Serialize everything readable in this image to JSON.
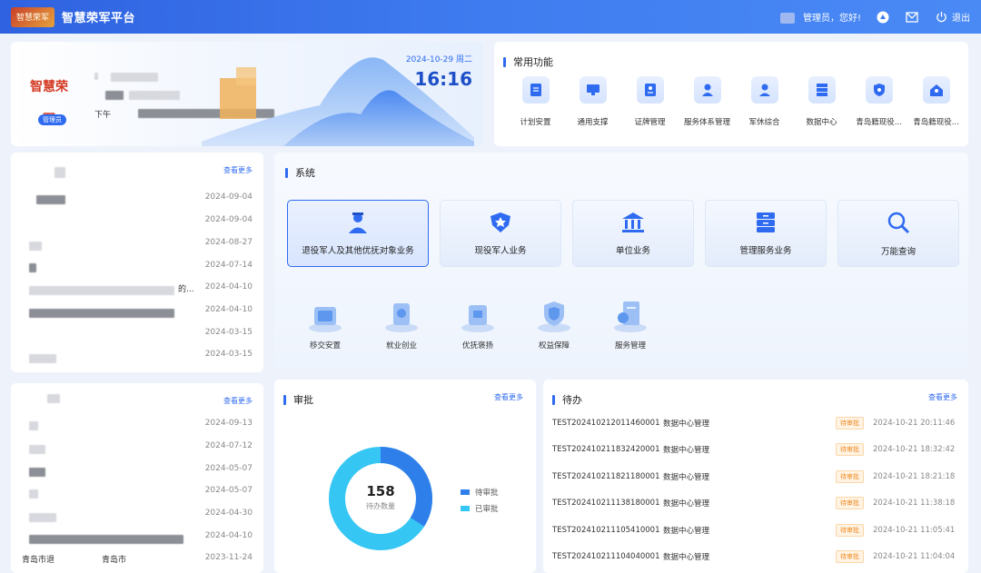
{
  "header": {
    "logo_text": "智慧荣军",
    "title": "智慧荣军平台",
    "user_text": "管理员，您好!",
    "logout_label": "退出"
  },
  "profile": {
    "logo_text": "智慧荣军",
    "role": "管理员",
    "greeting_prefix": "下午",
    "date": "2024-10-29 周二",
    "time": "16:16"
  },
  "common_functions": {
    "title": "常用功能",
    "items": [
      {
        "label": "计划安置",
        "icon": "plan-doc-icon"
      },
      {
        "label": "通用支撑",
        "icon": "monitor-icon"
      },
      {
        "label": "证牌管理",
        "icon": "id-card-icon"
      },
      {
        "label": "服务体系管理",
        "icon": "service-person-icon"
      },
      {
        "label": "军休综合",
        "icon": "retired-person-icon"
      },
      {
        "label": "数据中心",
        "icon": "server-icon"
      },
      {
        "label": "青岛籍现役...",
        "icon": "shield-icon"
      },
      {
        "label": "青岛籍现役...",
        "icon": "home-person-icon"
      }
    ]
  },
  "list_top": {
    "more": "查看更多",
    "rows": [
      {
        "date": "2024-09-04"
      },
      {
        "date": "2024-09-04"
      },
      {
        "date": "2024-08-27"
      },
      {
        "date": "2024-07-14"
      },
      {
        "date": "2024-04-10",
        "fragment": "的..."
      },
      {
        "date": "2024-04-10"
      },
      {
        "date": "2024-03-15"
      },
      {
        "date": "2024-03-15"
      }
    ]
  },
  "list_bottom": {
    "more": "查看更多",
    "rows": [
      {
        "date": "2024-09-13"
      },
      {
        "date": "2024-07-12"
      },
      {
        "date": "2024-05-07"
      },
      {
        "date": "2024-05-07"
      },
      {
        "date": "2024-04-30"
      },
      {
        "date": "2024-04-10"
      },
      {
        "date": "2023-11-24",
        "text_a": "青岛市退",
        "text_b": "青岛市"
      }
    ]
  },
  "system": {
    "title": "系统",
    "business": [
      {
        "label": "退役军人及其他优抚对象业务",
        "icon": "veteran-icon"
      },
      {
        "label": "现役军人业务",
        "icon": "military-badge-icon"
      },
      {
        "label": "单位业务",
        "icon": "bank-building-icon"
      },
      {
        "label": "管理服务业务",
        "icon": "cabinet-icon"
      },
      {
        "label": "万能查询",
        "icon": "search-icon"
      }
    ],
    "sub": [
      {
        "label": "移交安置",
        "icon": "transfer-icon"
      },
      {
        "label": "就业创业",
        "icon": "employment-icon"
      },
      {
        "label": "优抚褒扬",
        "icon": "honor-icon"
      },
      {
        "label": "权益保障",
        "icon": "rights-shield-icon"
      },
      {
        "label": "服务管理",
        "icon": "service-doc-icon"
      }
    ]
  },
  "approval": {
    "title": "审批",
    "more": "查看更多",
    "count": "158",
    "count_label": "待办数量",
    "legend": [
      {
        "label": "待审批",
        "color": "#2f7fea"
      },
      {
        "label": "已审批",
        "color": "#36c6f4"
      }
    ],
    "chart_data": {
      "type": "pie",
      "categories": [
        "待审批",
        "已审批"
      ],
      "values": [
        34,
        66
      ]
    }
  },
  "todo": {
    "title": "待办",
    "more": "查看更多",
    "rows": [
      {
        "code": "TEST20241021201146000​1",
        "type": "数据中心管理",
        "status": "待审批",
        "time": "2024-10-21 20:11:46"
      },
      {
        "code": "TEST202410211832420001",
        "type": "数据中心管理",
        "status": "待审批",
        "time": "2024-10-21 18:32:42"
      },
      {
        "code": "TEST202410211821180001",
        "type": "数据中心管理",
        "status": "待审批",
        "time": "2024-10-21 18:21:18"
      },
      {
        "code": "TEST202410211138180001",
        "type": "数据中心管理",
        "status": "待审批",
        "time": "2024-10-21 11:38:18"
      },
      {
        "code": "TEST202410211105410001",
        "type": "数据中心管理",
        "status": "待审批",
        "time": "2024-10-21 11:05:41"
      },
      {
        "code": "TEST202410211104040001",
        "type": "数据中心管理",
        "status": "待审批",
        "time": "2024-10-21 11:04:04"
      }
    ]
  }
}
